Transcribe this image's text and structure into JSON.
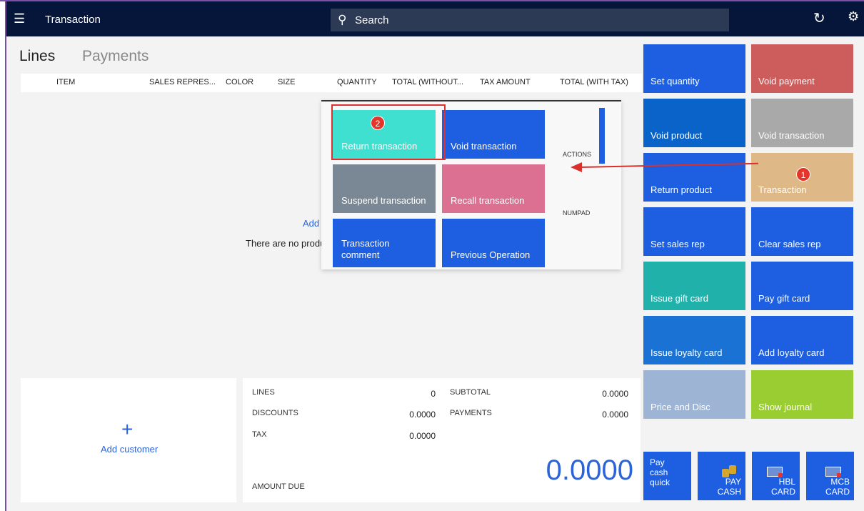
{
  "header": {
    "title": "Transaction",
    "search_placeholder": "Search"
  },
  "tabs": [
    {
      "label": "Lines"
    },
    {
      "label": "Payments"
    }
  ],
  "columns": [
    "ITEM",
    "SALES REPRES...",
    "COLOR",
    "SIZE",
    "QUANTITY",
    "TOTAL (WITHOUT...",
    "TAX AMOUNT",
    "TOTAL (WITH TAX)"
  ],
  "empty_state": {
    "add": "Add",
    "message": "There are no products"
  },
  "popup": {
    "tiles": [
      {
        "label": "Return transaction",
        "color": "#40e0d0"
      },
      {
        "label": "Void transaction",
        "color": "#1d5fe0"
      },
      {
        "label": "Suspend transaction",
        "color": "#7a8896"
      },
      {
        "label": "Recall transaction",
        "color": "#dc7093"
      },
      {
        "label": "Transaction comment",
        "color": "#1d5fe0"
      },
      {
        "label": "Previous Operation",
        "color": "#1d5fe0"
      }
    ],
    "side_labels": [
      "ACTIONS",
      "NUMPAD"
    ]
  },
  "annotations": {
    "badge1": "1",
    "badge2": "2"
  },
  "tiles": [
    {
      "label": "Set quantity",
      "color": "#1d5fe0"
    },
    {
      "label": "Void payment",
      "color": "#cd5c5c"
    },
    {
      "label": "Void product",
      "color": "#0a63c9"
    },
    {
      "label": "Void transaction",
      "color": "#a9a9a9"
    },
    {
      "label": "Return product",
      "color": "#1d5fe0"
    },
    {
      "label": "Transaction",
      "color": "#deb887"
    },
    {
      "label": "Set sales rep",
      "color": "#1d5fe0"
    },
    {
      "label": "Clear sales rep",
      "color": "#1d5fe0"
    },
    {
      "label": "Issue gift card",
      "color": "#20b2aa"
    },
    {
      "label": "Pay gift card",
      "color": "#1d5fe0"
    },
    {
      "label": "Issue loyalty card",
      "color": "#1a73d4"
    },
    {
      "label": "Add loyalty card",
      "color": "#1d5fe0"
    },
    {
      "label": "Price and Disc",
      "color": "#9db4d4"
    },
    {
      "label": "Show journal",
      "color": "#9acd32"
    }
  ],
  "customer": {
    "add_label": "Add customer"
  },
  "totals": {
    "lines_label": "LINES",
    "lines_value": "0",
    "discounts_label": "DISCOUNTS",
    "discounts_value": "0.0000",
    "tax_label": "TAX",
    "tax_value": "0.0000",
    "subtotal_label": "SUBTOTAL",
    "subtotal_value": "0.0000",
    "payments_label": "PAYMENTS",
    "payments_value": "0.0000",
    "amount_due_label": "AMOUNT DUE",
    "amount_due_value": "0.0000"
  },
  "small_tiles": [
    {
      "label": "Pay cash quick"
    },
    {
      "label": "PAY CASH"
    },
    {
      "label": "HBL CARD"
    },
    {
      "label": "MCB CARD"
    }
  ]
}
